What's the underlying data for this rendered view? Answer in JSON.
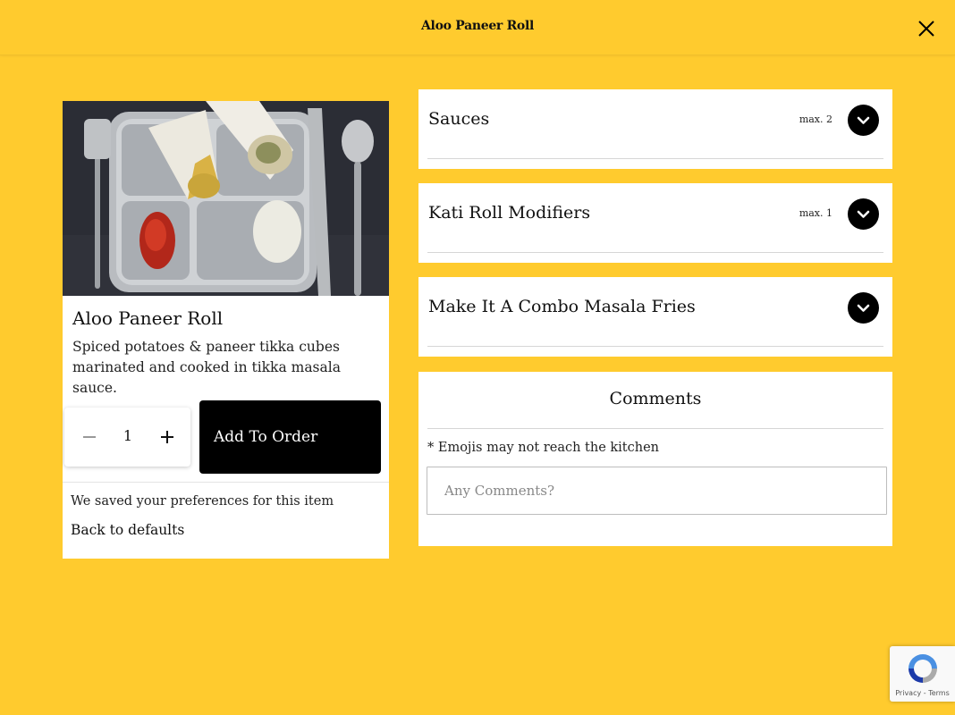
{
  "header": {
    "title": "Aloo Paneer Roll",
    "close_icon": "close-icon"
  },
  "item": {
    "name": "Aloo Paneer Roll",
    "description": "Spiced potatoes & paneer tikka cubes marinated and cooked in tikka masala sauce.",
    "photo_alt": "Aloo Paneer Roll on a steel tray with sauces",
    "quantity": "1",
    "add_label": "Add To Order",
    "saved_text": "We saved your preferences for this item",
    "back_label": "Back to defaults"
  },
  "modifiers": [
    {
      "title": "Sauces",
      "max": "max. 2"
    },
    {
      "title": "Kati Roll Modifiers",
      "max": "max. 1"
    },
    {
      "title": "Make It A Combo Masala Fries",
      "max": ""
    }
  ],
  "comments": {
    "title": "Comments",
    "note": "* Emojis may not reach the kitchen",
    "placeholder": "Any Comments?"
  },
  "recaptcha": {
    "links": "Privacy - Terms"
  },
  "colors": {
    "background": "#FFCB2E",
    "card": "#FFFFFF",
    "button": "#000000"
  }
}
